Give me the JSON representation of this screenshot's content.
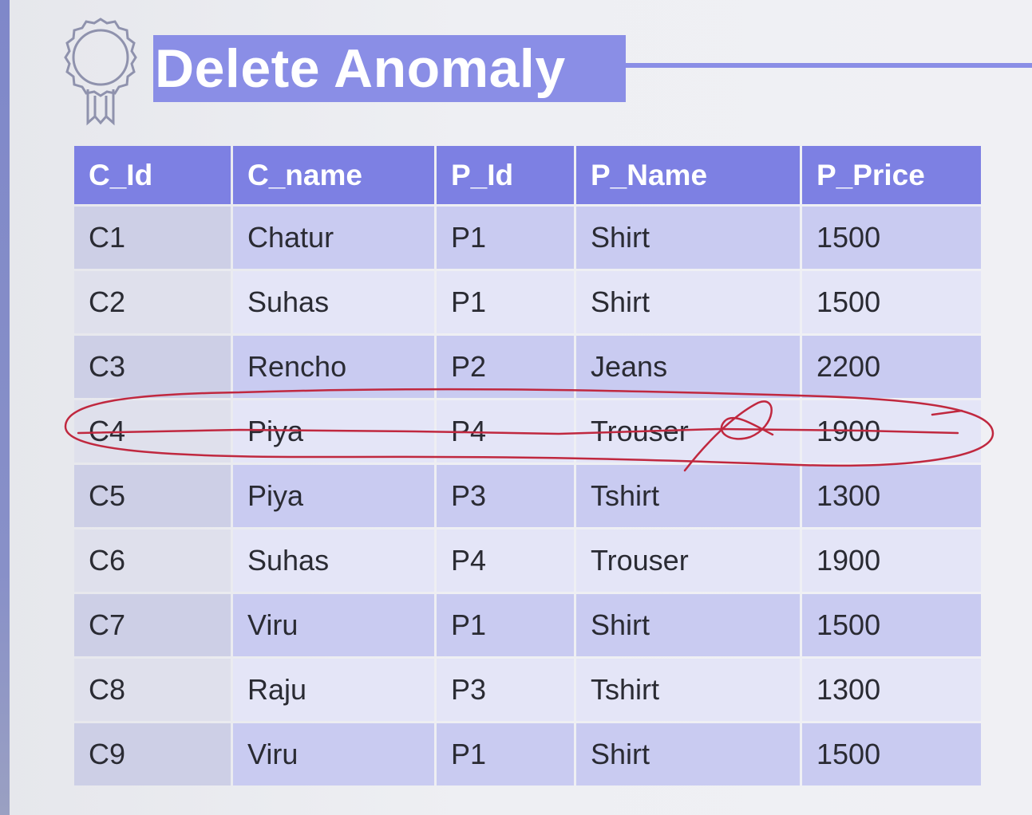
{
  "slide": {
    "title": "Delete Anomaly",
    "icon": "award-ribbon-icon",
    "accent_color": "#8a8ee6",
    "header_color": "#7d80e3",
    "annotation_color": "#c0283f"
  },
  "table": {
    "columns": [
      "C_Id",
      "C_name",
      "P_Id",
      "P_Name",
      "P_Price"
    ],
    "rows": [
      [
        "C1",
        "Chatur",
        "P1",
        "Shirt",
        "1500"
      ],
      [
        "C2",
        "Suhas",
        "P1",
        "Shirt",
        "1500"
      ],
      [
        "C3",
        "Rencho",
        "P2",
        "Jeans",
        "2200"
      ],
      [
        "C4",
        "Piya",
        "P4",
        "Trouser",
        "1900"
      ],
      [
        "C5",
        "Piya",
        "P3",
        "Tshirt",
        "1300"
      ],
      [
        "C6",
        "Suhas",
        "P4",
        "Trouser",
        "1900"
      ],
      [
        "C7",
        "Viru",
        "P1",
        "Shirt",
        "1500"
      ],
      [
        "C8",
        "Raju",
        "P3",
        "Tshirt",
        "1300"
      ],
      [
        "C9",
        "Viru",
        "P1",
        "Shirt",
        "1500"
      ]
    ],
    "struck_row": "C4"
  }
}
